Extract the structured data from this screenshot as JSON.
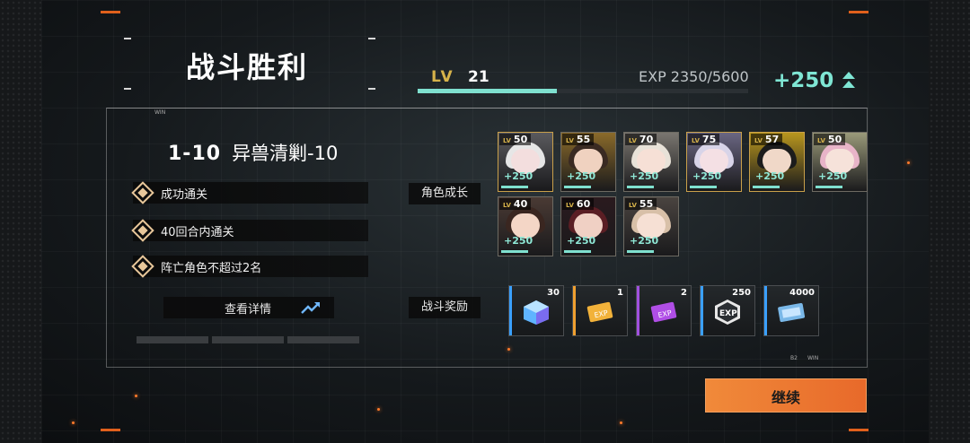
{
  "header": {
    "title": "战斗胜利"
  },
  "player": {
    "lv_label": "LV",
    "lv_value": "21",
    "exp_text": "EXP 2350/5600",
    "exp_gain": "+250",
    "exp_progress": 0.42
  },
  "stage": {
    "code": "1-10",
    "name": "异兽清剿-10"
  },
  "objectives": [
    "成功通关",
    "40回合内通关",
    "阵亡角色不超过2名"
  ],
  "details_button": {
    "label": "查看详情"
  },
  "sections": {
    "growth": "角色成长",
    "rewards": "战斗奖励"
  },
  "frame_tags": {
    "win": "WIN",
    "win_small": "WIN",
    "win_code": "B2"
  },
  "characters": [
    {
      "lv": "50",
      "exp": "+250",
      "hair": "#e6e6e6",
      "skin": "#f3dede",
      "bg": "#5a5a5e",
      "border": "#c9a04a"
    },
    {
      "lv": "55",
      "exp": "+250",
      "hair": "#3a2a22",
      "skin": "#f0d2c0",
      "bg": "#8a6a2a",
      "border": "#6d6a62"
    },
    {
      "lv": "70",
      "exp": "+250",
      "hair": "#e8e2d8",
      "skin": "#f6e0d6",
      "bg": "#7a7670",
      "border": "#6d6a62"
    },
    {
      "lv": "75",
      "exp": "+250",
      "hair": "#d8d4e8",
      "skin": "#f4e0e4",
      "bg": "#6a6682",
      "border": "#c9a04a"
    },
    {
      "lv": "57",
      "exp": "+250",
      "hair": "#1c1c1c",
      "skin": "#f0d8c8",
      "bg": "#b8961e",
      "border": "#c9a04a"
    },
    {
      "lv": "50",
      "exp": "+250",
      "hair": "#e8b4c8",
      "skin": "#f6e2da",
      "bg": "#9a9a7a",
      "border": "#6d6a62"
    },
    {
      "lv": "40",
      "exp": "+250",
      "hair": "#3a2620",
      "skin": "#f4d6c6",
      "bg": "#4a3a34",
      "border": "#6d6a62"
    },
    {
      "lv": "60",
      "exp": "+250",
      "hair": "#5a1e24",
      "skin": "#f0d0c4",
      "bg": "#2a1a1e",
      "border": "#6d6a62"
    },
    {
      "lv": "55",
      "exp": "+250",
      "hair": "#d8c0a8",
      "skin": "#f6e0d4",
      "bg": "#4a4440",
      "border": "#6d6a62"
    }
  ],
  "rewards": [
    {
      "count": "30",
      "icon": "crystal-cube-icon",
      "strip": "#3aa0ff"
    },
    {
      "count": "1",
      "icon": "exp-ticket-gold-icon",
      "strip": "#f0a030"
    },
    {
      "count": "2",
      "icon": "exp-ticket-purple-icon",
      "strip": "#a050e0"
    },
    {
      "count": "250",
      "icon": "exp-badge-icon",
      "strip": "#3aa0ff"
    },
    {
      "count": "4000",
      "icon": "currency-ticket-icon",
      "strip": "#3aa0ff"
    }
  ],
  "continue_button": {
    "label": "继续"
  },
  "colors": {
    "accent_teal": "#7fe0cf",
    "accent_orange": "#e8692a",
    "gold": "#d6b24a"
  }
}
